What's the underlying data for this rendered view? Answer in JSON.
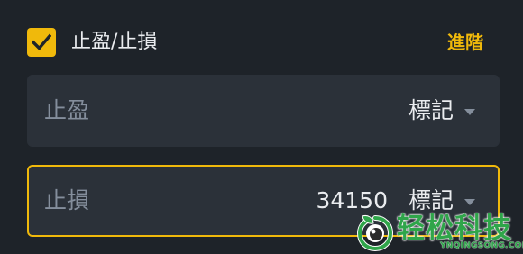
{
  "header": {
    "checkbox_checked": true,
    "label": "止盈/止損",
    "advanced_label": "進階",
    "accent_color": "#f0b90b"
  },
  "take_profit": {
    "label": "止盈",
    "value": "",
    "mark_label": "標記"
  },
  "stop_loss": {
    "label": "止損",
    "value": "34150",
    "mark_label": "標記"
  },
  "watermark": {
    "text": "轻松科技",
    "subtext": "YNQINGSONG.COM"
  }
}
